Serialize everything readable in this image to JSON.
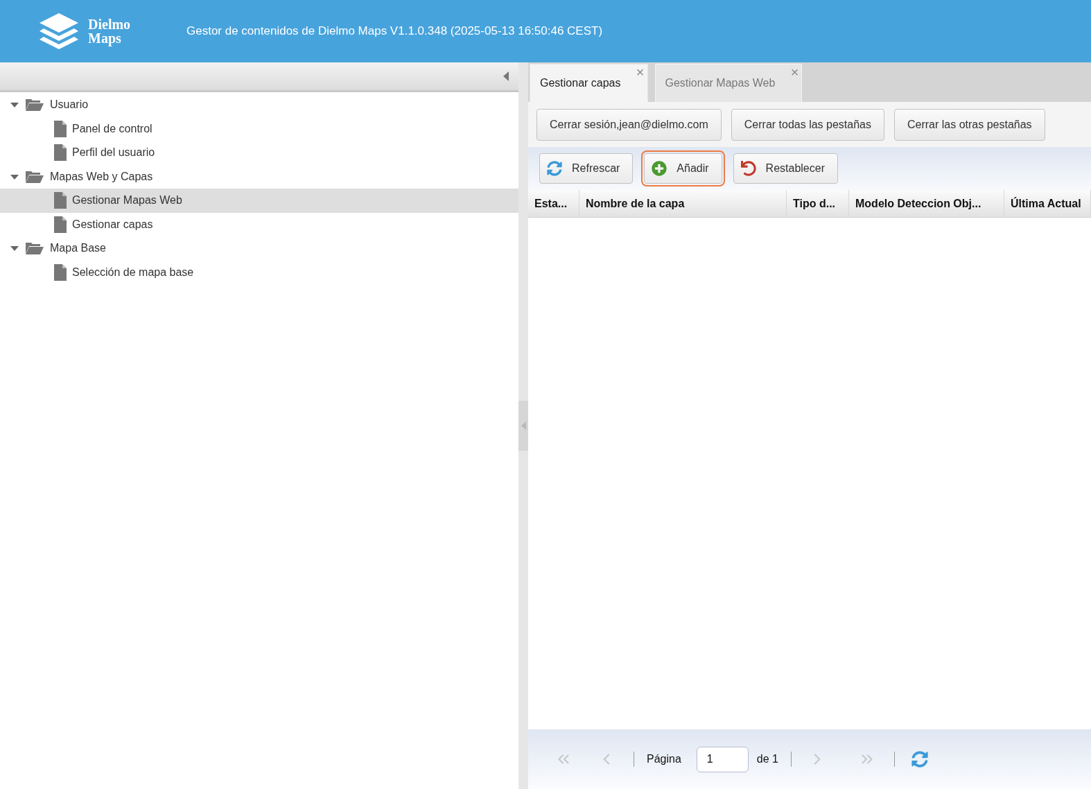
{
  "header": {
    "logo_text": [
      "Dielmo",
      "Maps"
    ],
    "title": "Gestor de contenidos de Dielmo Maps V1.1.0.348 (2025-05-13 16:50:46 CEST)"
  },
  "tree": [
    {
      "label": "Usuario",
      "kind": "folder",
      "expanded": true,
      "selected": false,
      "children": [
        {
          "label": "Panel de control",
          "kind": "page",
          "selected": false
        },
        {
          "label": "Perfil del usuario",
          "kind": "page",
          "selected": false
        }
      ]
    },
    {
      "label": "Mapas Web y Capas",
      "kind": "folder",
      "expanded": true,
      "selected": false,
      "children": [
        {
          "label": "Gestionar Mapas Web",
          "kind": "page",
          "selected": true
        },
        {
          "label": "Gestionar capas",
          "kind": "page",
          "selected": false
        }
      ]
    },
    {
      "label": "Mapa Base",
      "kind": "folder",
      "expanded": true,
      "selected": false,
      "children": [
        {
          "label": "Selección de mapa base",
          "kind": "page",
          "selected": false
        }
      ]
    }
  ],
  "tabs": [
    {
      "label": "Gestionar capas",
      "selected": true,
      "close": "×"
    },
    {
      "label": "Gestionar Mapas Web",
      "selected": false,
      "close": "×"
    }
  ],
  "session_buttons": [
    "Cerrar sesión,jean@dielmo.com",
    "Cerrar todas las pestañas",
    "Cerrar las otras pestañas"
  ],
  "toolbar": [
    {
      "label": "Refrescar",
      "kind": "refresh",
      "focused": false
    },
    {
      "label": "Añadir",
      "kind": "add",
      "focused": true
    },
    {
      "label": "Restablecer",
      "kind": "reset",
      "focused": false
    }
  ],
  "table": {
    "columns": [
      "Esta...",
      "Nombre de la capa",
      "Tipo d...",
      "Modelo Deteccion Obj...",
      "Última Actual"
    ]
  },
  "pager": {
    "page_label": "Página",
    "page": "1",
    "of_label": "de 1"
  }
}
